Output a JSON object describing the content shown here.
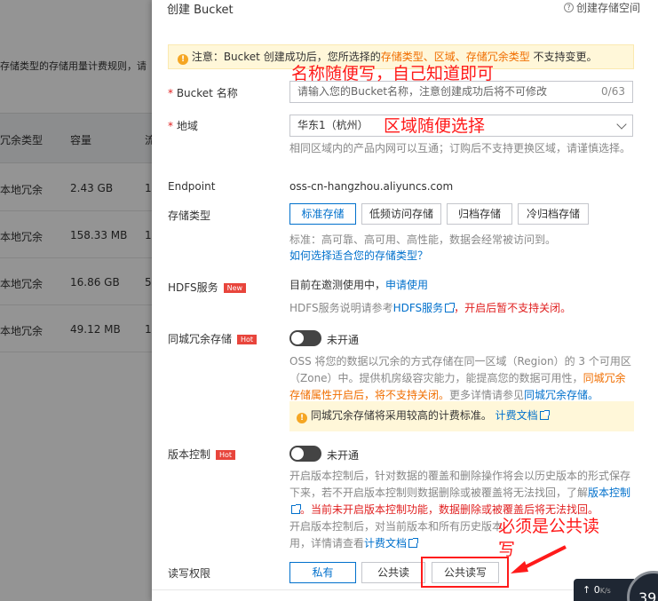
{
  "background": {
    "notice": "存储类型的存储用量计费规则，请",
    "headers": [
      "冗余类型",
      "容量",
      "流"
    ],
    "rows": [
      {
        "type": "本地冗余",
        "size": "2.43 GB",
        "extra": "1"
      },
      {
        "type": "本地冗余",
        "size": "158.33 MB",
        "extra": "1"
      },
      {
        "type": "本地冗余",
        "size": "16.86 GB",
        "extra": "5"
      },
      {
        "type": "本地冗余",
        "size": "49.12 MB",
        "extra": "1"
      }
    ]
  },
  "panel": {
    "title": "创建 Bucket",
    "help_label": "创建存储空间",
    "help_icon": "?",
    "notice": {
      "prefix": "注意：Bucket 创建成功后，您所选择的",
      "highlight": "存储类型、区域、存储冗余类型",
      "suffix": "不支持变更。"
    },
    "bucket_name": {
      "label": "Bucket 名称",
      "placeholder": "请输入您的Bucket名称，注意创建成功后将不可修改",
      "counter": "0/63"
    },
    "region": {
      "label": "地域",
      "value": "华东1（杭州）",
      "hint": "相同区域内的产品内网可以互通；订购后不支持更换区域，请谨慎选择。"
    },
    "endpoint": {
      "label": "Endpoint",
      "value": "oss-cn-hangzhou.aliyuncs.com"
    },
    "storage_type": {
      "label": "存储类型",
      "options": [
        "标准存储",
        "低频访问存储",
        "归档存储",
        "冷归档存储"
      ],
      "selected": "标准存储",
      "hint": "标准：高可靠、高可用、高性能，数据会经常被访问到。",
      "link": "如何选择适合您的存储类型？"
    },
    "hdfs": {
      "label": "HDFS服务",
      "badge": "New",
      "status": "目前在邀测使用中，",
      "apply_link": "申请使用",
      "desc_prefix": "HDFS服务说明请参考",
      "desc_link": "HDFS服务",
      "desc_warn": "，开启后暂不支持关闭。"
    },
    "zrs": {
      "label": "同城冗余存储",
      "badge": "Hot",
      "toggle": "未开通",
      "desc1": "OSS 将您的数据以冗余的方式存储在同一区域（Region）的 3 个可用区（Zone）中。提供机房级容灾能力，能提高您的数据可用性，",
      "desc_warn": "同城冗余存储属性开启后，将不支持关闭。",
      "desc2": "更多详情请参见",
      "desc_link": "同城冗余存储。",
      "billing_note": "同城冗余存储将采用较高的计费标准。",
      "billing_link": "计费文档"
    },
    "versioning": {
      "label": "版本控制",
      "badge": "Hot",
      "toggle": "未开通",
      "desc1": "开启版本控制后，针对数据的覆盖和删除操作将会以历史版本的形式保存下来，若不开启版本控制则数据删除或被覆盖将无法找回，了解",
      "desc_link": "版本控制",
      "desc_warn": "。当前未开启版本控制功能，数据删除或被覆盖后将无法找回。",
      "desc2": "开启版本控制后，对当前版本和所有历史版本",
      "desc3": "用，详情请查看",
      "desc_link2": "计费文档"
    },
    "acl": {
      "label": "读写权限",
      "options": [
        "私有",
        "公共读",
        "公共读写"
      ],
      "selected": "私有"
    }
  },
  "annotations": {
    "name_note": "名称随便写，自己知道即可",
    "region_note": "区域随便选择",
    "acl_note_line1": "必须是公共读",
    "acl_note_line2": "写"
  },
  "status": {
    "speed": "0",
    "speed_unit": "K/s",
    "circle": "39"
  },
  "colors": {
    "accent": "#0070cc",
    "warning": "#f06e00",
    "danger": "#e02020",
    "annotation": "#ff1a1a"
  }
}
